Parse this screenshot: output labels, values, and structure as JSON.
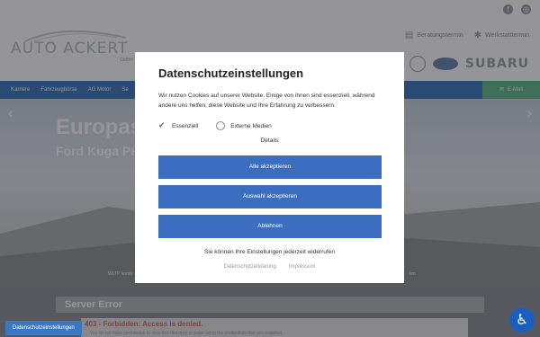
{
  "header": {
    "logo_text": "AUTO ACKERT",
    "logo_sub": "GMBH",
    "social": [
      {
        "icon": "facebook-icon",
        "glyph": "f"
      },
      {
        "icon": "instagram-icon",
        "glyph": "◎"
      }
    ],
    "links": [
      {
        "icon": "calendar-icon",
        "glyph": "▤",
        "label": "Beratungstermin"
      },
      {
        "icon": "wrench-icon",
        "glyph": "✱",
        "label": "Werkstatttermin"
      }
    ],
    "brand_text": "SUBARU"
  },
  "nav": {
    "items": [
      "Karriere",
      "Fahrzeugbörse",
      "AG Motor",
      "Se"
    ],
    "mail_label": "E-Mail",
    "mail_glyph": "✉"
  },
  "hero": {
    "title": "Europas",
    "subtitle": "Ford Kuga PH",
    "foot_left": "WLTP komb",
    "foot_right": "km",
    "prev_glyph": "‹",
    "next_glyph": "›"
  },
  "error": {
    "title": "Server Error",
    "code": "403 - Forbidden: Access is denied.",
    "desc": "You do not have permission to view this directory or page using the credentials that you supplied."
  },
  "modal": {
    "title": "Datenschutzeinstellungen",
    "text": "Wir nutzen Cookies auf unserer Website. Einige von ihnen sind essenziell, während andere uns helfen, diese Website und Ihre Erfahrung zu verbessern.",
    "checks": [
      {
        "label": "Essenziell",
        "checked": true
      },
      {
        "label": "Externe Medien",
        "checked": false
      }
    ],
    "details": "Details",
    "buttons": [
      "Alle akzeptieren",
      "Auswahl akzeptieren",
      "Ablehnen"
    ],
    "note": "Sie können Ihre Einstellungen jederzeit widerrufen",
    "links": [
      "Datenschutzerklärung",
      "Impressum"
    ]
  },
  "footer": {
    "privacy_button": "Datenschutzeinstellungen",
    "accessibility_glyph": "♿"
  }
}
